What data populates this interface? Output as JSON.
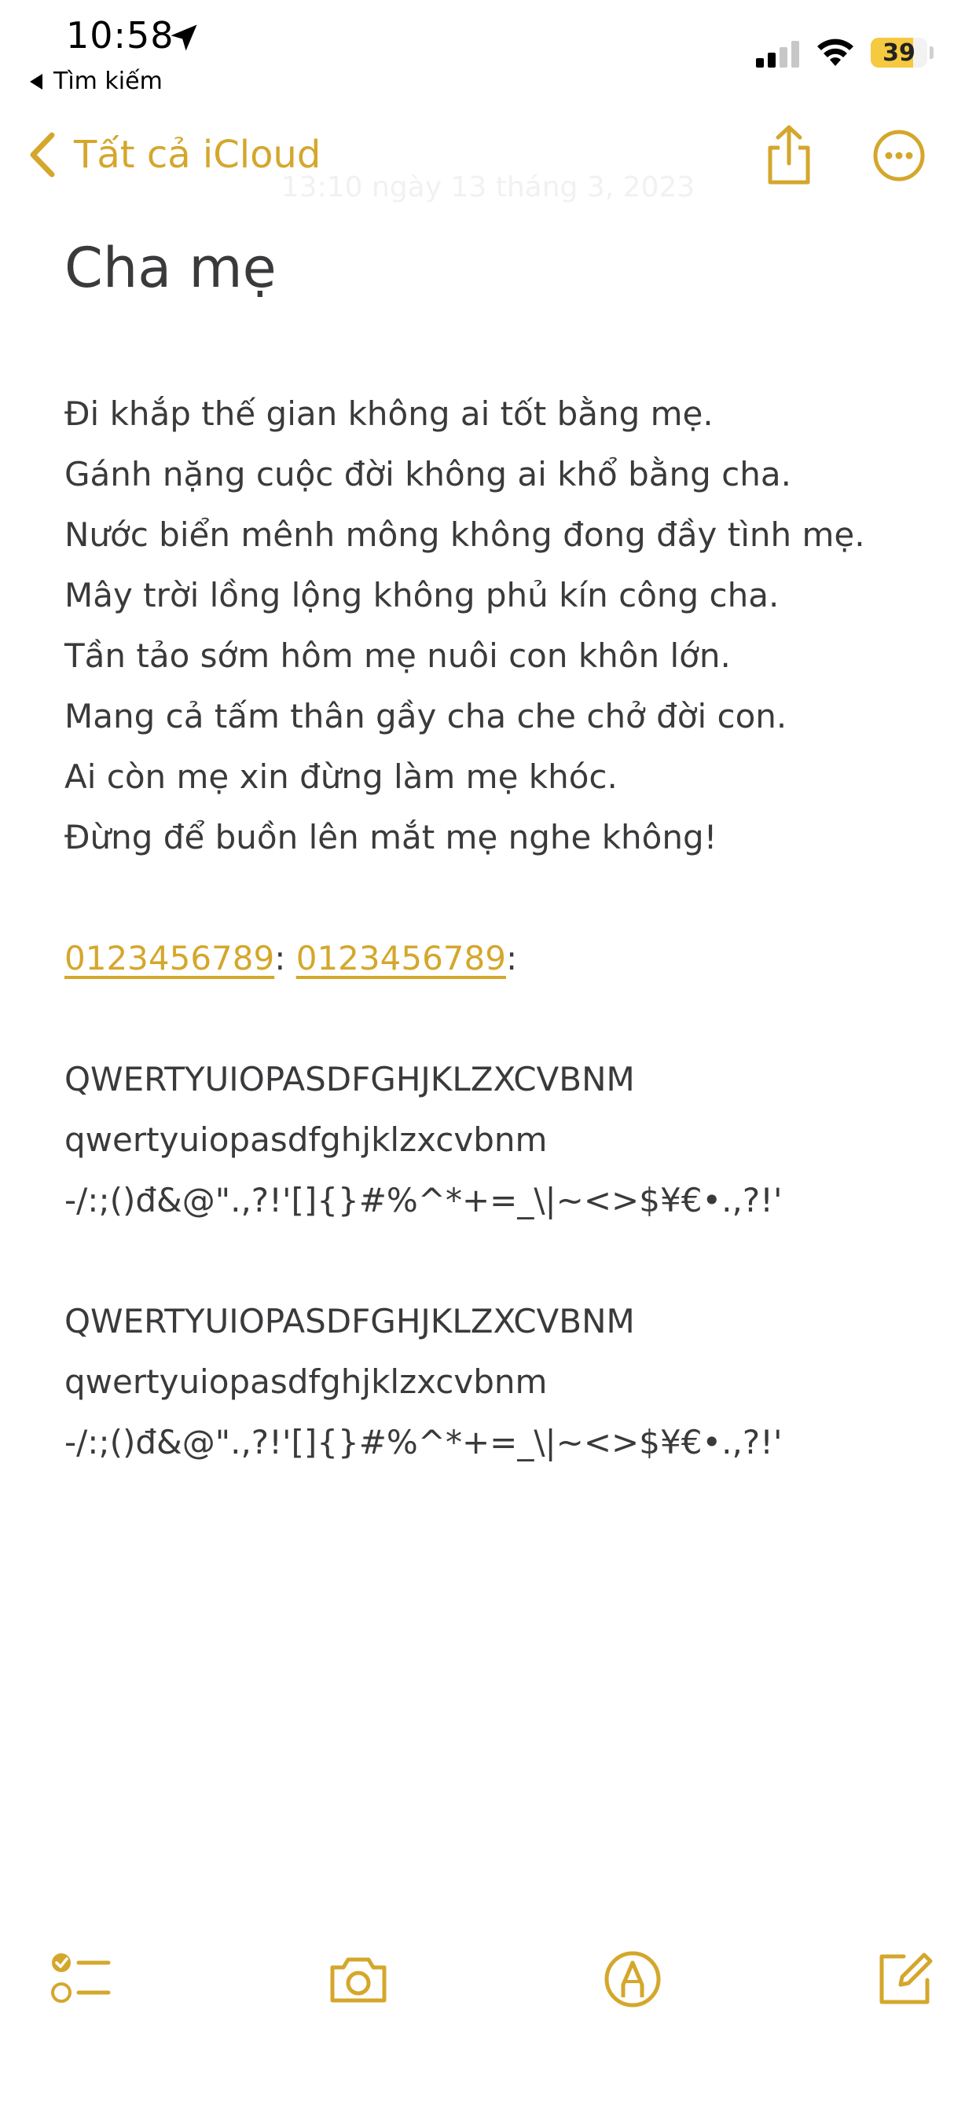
{
  "status_bar": {
    "time": "10:58",
    "back_app": "Tìm kiếm",
    "battery": "39"
  },
  "nav": {
    "back_label": "Tất cả iCloud",
    "faded_date": "13:10 ngày 13 tháng 3, 2023"
  },
  "note": {
    "title": "Cha mẹ",
    "poem": [
      "Đi khắp thế gian không ai tốt bằng mẹ.",
      "Gánh nặng cuộc đời không ai khổ bằng cha.",
      "Nước biển mênh mông không đong đầy tình mẹ.",
      "Mây trời lồng lộng không phủ kín công cha.",
      "Tần tảo sớm hôm mẹ nuôi con khôn lớn.",
      "Mang cả tấm thân gầy cha che chở đời con.",
      "Ai còn mẹ xin đừng làm mẹ khóc.",
      "Đừng để buồn lên mắt mẹ nghe không!"
    ],
    "phone_1": "0123456789",
    "phone_sep": ": ",
    "phone_2": "0123456789",
    "phone_end": ":",
    "chars_block_1": [
      "QWERTYUIOPASDFGHJKLZXCVBNM",
      "qwertyuiopasdfghjklzxcvbnm",
      "-/:;()đ&@\".,?!'[]{}#%^*+=_\\|~<>$¥€•.,?!'"
    ],
    "chars_block_2": [
      "QWERTYUIOPASDFGHJKLZXCVBNM",
      "qwertyuiopasdfghjklzxcvbnm",
      "-/:;()đ&@\".,?!'[]{}#%^*+=_\\|~<>$¥€•.,?!'"
    ]
  },
  "toolbar": {
    "items": [
      "checklist-icon",
      "camera-icon",
      "markup-pen-icon",
      "compose-icon"
    ]
  },
  "colors": {
    "accent": "#d4a72c",
    "text": "#3a3a3c",
    "battery": "#f5c940"
  }
}
